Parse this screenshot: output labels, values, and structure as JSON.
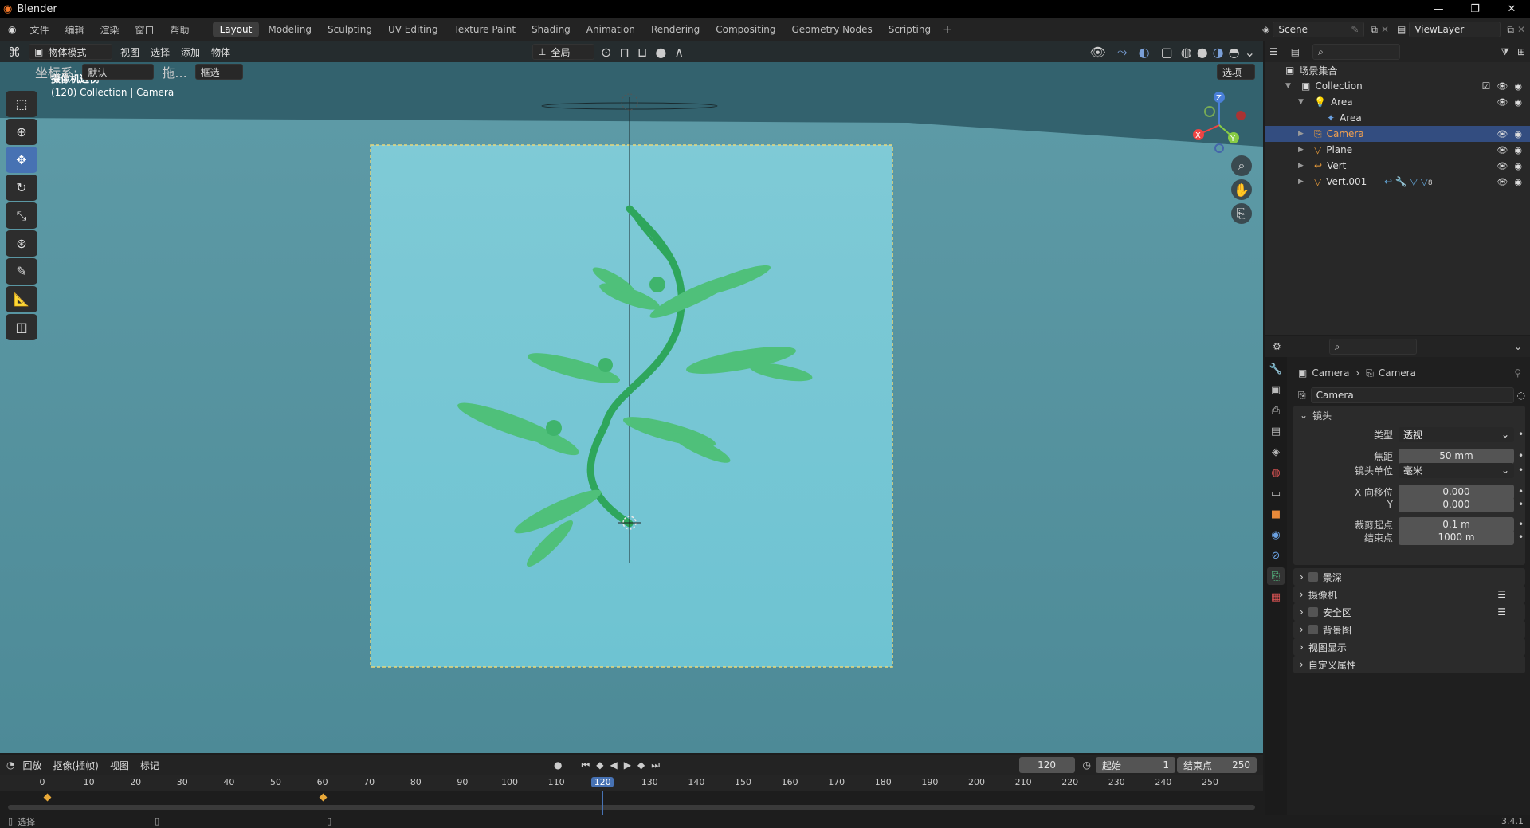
{
  "window": {
    "app_title": "Blender",
    "version": "3.4.1"
  },
  "menu": [
    "文件",
    "编辑",
    "渲染",
    "窗口",
    "帮助"
  ],
  "workspaces": [
    "Layout",
    "Modeling",
    "Sculpting",
    "UV Editing",
    "Texture Paint",
    "Shading",
    "Animation",
    "Rendering",
    "Compositing",
    "Geometry Nodes",
    "Scripting"
  ],
  "active_workspace": "Layout",
  "scene": {
    "name": "Scene",
    "view_layer": "ViewLayer"
  },
  "viewport_header": {
    "mode": "物体模式",
    "menus": [
      "视图",
      "选择",
      "添加",
      "物体"
    ],
    "transform": "全局",
    "coord_label": "坐标系:",
    "coord_value": "默认",
    "drag_label": "拖...",
    "select_mode": "框选",
    "options": "选项"
  },
  "viewport": {
    "title": "摄像机透视",
    "subtitle": "(120) Collection | Camera"
  },
  "outliner": {
    "root": "场景集合",
    "items": [
      {
        "label": "Collection",
        "depth": 0
      },
      {
        "label": "Area",
        "depth": 1
      },
      {
        "label": "Area",
        "depth": 2
      },
      {
        "label": "Camera",
        "depth": 1,
        "selected": true
      },
      {
        "label": "Plane",
        "depth": 1
      },
      {
        "label": "Vert",
        "depth": 1
      },
      {
        "label": "Vert.001",
        "depth": 1
      }
    ],
    "modifier_count": "8"
  },
  "properties": {
    "breadcrumb": [
      "Camera",
      "Camera"
    ],
    "datablock": "Camera",
    "section": "镜头",
    "fields": [
      {
        "label": "类型",
        "value": "透视",
        "dropdown": true
      },
      {
        "label": "焦距",
        "value": "50 mm"
      },
      {
        "label": "镜头单位",
        "value": "毫米",
        "dropdown": true
      },
      {
        "label": "X 向移位",
        "value": "0.000"
      },
      {
        "label": "Y",
        "value": "0.000"
      },
      {
        "label": "裁剪起点",
        "value": "0.1 m"
      },
      {
        "label": "结束点",
        "value": "1000 m"
      }
    ],
    "panels": [
      "景深",
      "摄像机",
      "安全区",
      "背景图",
      "视图显示",
      "自定义属性"
    ]
  },
  "timeline": {
    "menus": [
      "回放",
      "抠像(插帧)",
      "视图",
      "标记"
    ],
    "current_frame": "120",
    "start_label": "起始",
    "start": "1",
    "end_label": "结束点",
    "end": "250",
    "ruler": [
      "0",
      "10",
      "20",
      "30",
      "40",
      "50",
      "60",
      "70",
      "80",
      "90",
      "100",
      "110",
      "120",
      "130",
      "140",
      "150",
      "160",
      "170",
      "180",
      "190",
      "200",
      "210",
      "220",
      "230",
      "240",
      "250"
    ],
    "keyframes": [
      1,
      60
    ]
  },
  "status": {
    "left": "选择"
  },
  "colors": {
    "accent": "#4772b3",
    "selection": "#334d80",
    "bg": "#3a6e7b",
    "frame": "#79c8d5"
  }
}
